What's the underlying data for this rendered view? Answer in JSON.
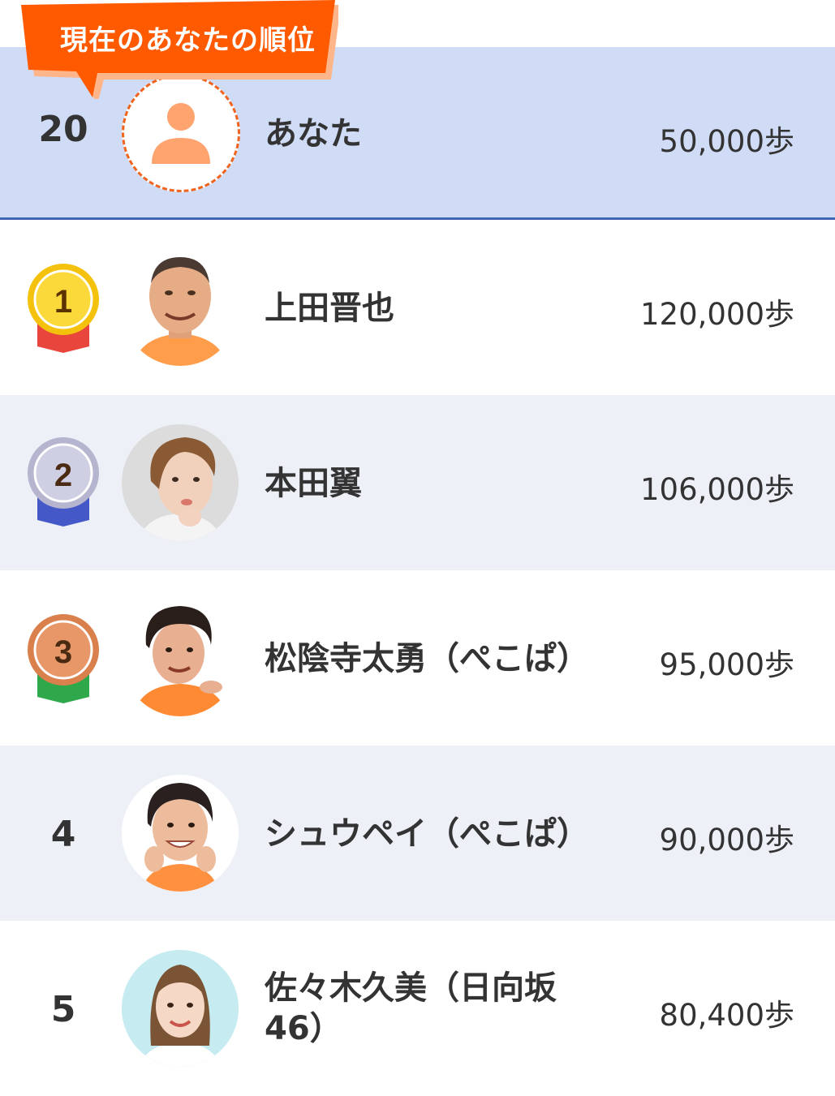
{
  "current_user": {
    "badge_label": "現在のあなたの順位",
    "rank": "20",
    "name": "あなた",
    "steps": "50,000歩",
    "avatar_icon": "person-icon"
  },
  "rankings": [
    {
      "rank": "1",
      "name": "上田晋也",
      "steps": "120,000歩",
      "medal": "gold"
    },
    {
      "rank": "2",
      "name": "本田翼",
      "steps": "106,000歩",
      "medal": "silver"
    },
    {
      "rank": "3",
      "name": "松陰寺太勇（ぺこぱ）",
      "steps": "95,000歩",
      "medal": "bronze"
    },
    {
      "rank": "4",
      "name": "シュウペイ（ぺこぱ）",
      "steps": "90,000歩"
    },
    {
      "rank": "5",
      "name_line1": "佐々木久美（日向坂",
      "name_line2": "46）",
      "steps": "80,400歩"
    }
  ],
  "colors": {
    "highlight_bg": "#d0dbf6",
    "highlight_border": "#3d67b4",
    "alt_row_bg": "#eef0f8",
    "badge_orange": "#ff5a00",
    "gold": "#f4c20d",
    "silver": "#b5b5cf",
    "bronze": "#d9804c"
  }
}
